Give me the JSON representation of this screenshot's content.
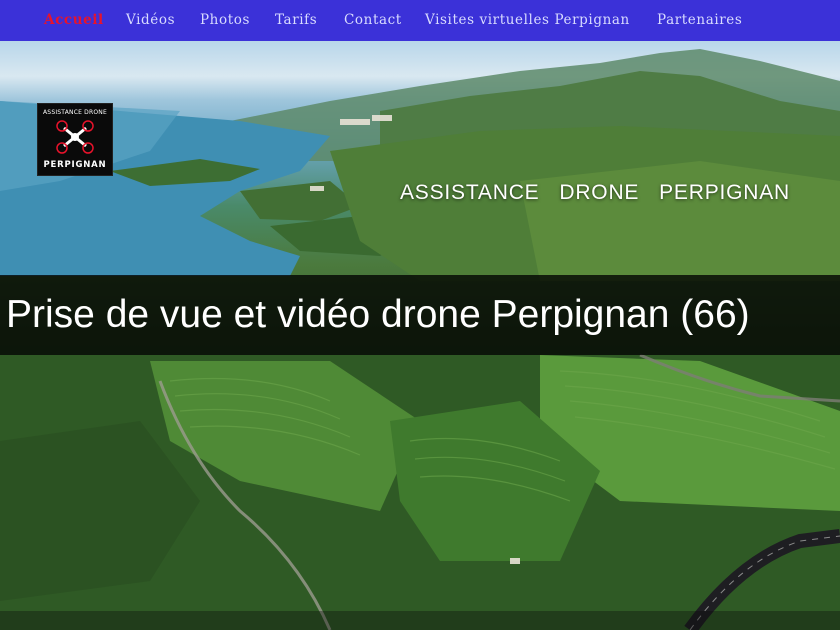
{
  "nav": {
    "items": [
      {
        "label": "Accueil",
        "active": true
      },
      {
        "label": "Vidéos"
      },
      {
        "label": "Photos"
      },
      {
        "label": "Tarifs"
      },
      {
        "label": "Contact"
      },
      {
        "label": "Visites virtuelles Perpignan"
      },
      {
        "label": "Partenaires"
      }
    ]
  },
  "logo": {
    "top_text": "ASSISTANCE DRONE",
    "bottom_text": "PERPIGNAN"
  },
  "hero": {
    "brand": "ASSISTANCE   DRONE   PERPIGNAN",
    "headline": "Prise de vue et vidéo drone Perpignan (66)"
  },
  "colors": {
    "nav_bg": "#3b31d8",
    "nav_text": "#d8dbff",
    "nav_active": "#e8132b"
  }
}
